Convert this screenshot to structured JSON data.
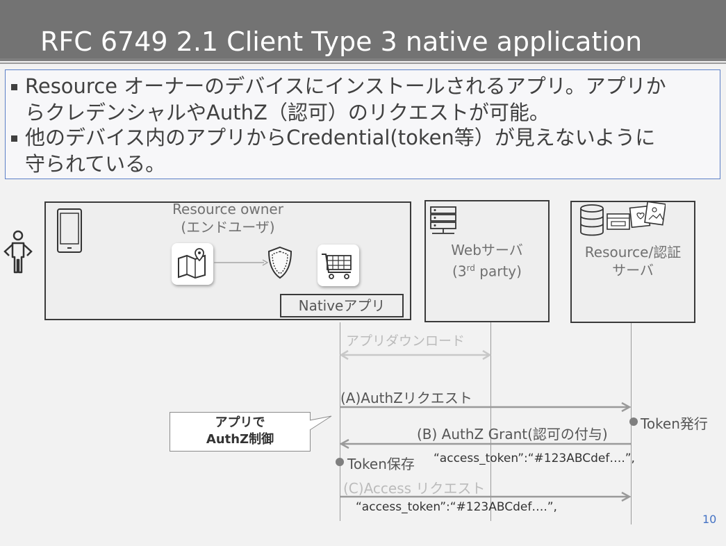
{
  "slide": {
    "title": "RFC 6749 2.1 Client Type 3 native application",
    "page_number": "10"
  },
  "bullets": [
    {
      "line1": "Resource オーナーのデバイスにインストールされるアプリ。アプリか",
      "line2": "らクレデンシャルやAuthZ（認可）のリクエストが可能。"
    },
    {
      "line1": "他のデバイス内のアプリからCredential(token等）が見えないように",
      "line2": "守られている。"
    }
  ],
  "diagram": {
    "device_box": {
      "title_line1": "Resource owner",
      "title_line2": "(エンドユーザ)",
      "native_label": "Nativeアプリ",
      "icons": [
        "person-icon",
        "smartphone-icon",
        "map-icon",
        "shield-icon",
        "cart-icon"
      ]
    },
    "web_server": {
      "line1": "Webサーバ",
      "line2_prefix": "(3",
      "line2_sup": "rd",
      "line2_suffix": " party)",
      "icon": "server-icon"
    },
    "resource_server": {
      "line1": "Resource/認証",
      "line2": "サーバ",
      "icons": [
        "database-icon",
        "photos-icon"
      ]
    },
    "flows": {
      "download": "アプリダウンロード",
      "a_request": "(A)AuthZリクエスト",
      "b_grant": "(B) AuthZ Grant(認可の付与)",
      "b_token": "“access_token”:“#123ABCdef….”,",
      "c_request": "(C)Access リクエスト",
      "c_token": "“access_token”:“#123ABCdef….”,",
      "token_issued": "Token発行",
      "token_saved": "Token保存"
    },
    "callout": {
      "line1": "アプリで",
      "line2": "AuthZ制御"
    }
  }
}
